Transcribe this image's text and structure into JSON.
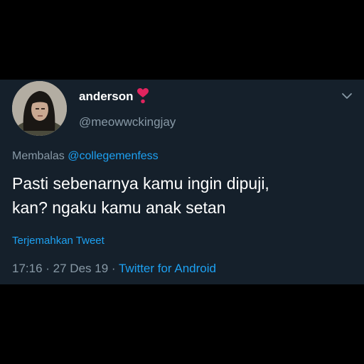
{
  "tweet": {
    "author": {
      "display_name": "anderson",
      "name_emoji": "heart-exclamation-emoji",
      "handle": "@meowwckingjay"
    },
    "reply": {
      "prefix": "Membalas",
      "mention": "@collegemenfess"
    },
    "text": {
      "line1": "Pasti sebenarnya kamu ingin dipuji,",
      "line2": "kan? ngaku kamu anak setan"
    },
    "translate_label": "Terjemahkan Tweet",
    "meta": {
      "time": "17:16",
      "separator1": " · ",
      "date": "27 Des 19",
      "separator2": " · ",
      "source": "Twitter for Android"
    },
    "menu_icon": "chevron-down-icon"
  },
  "colors": {
    "background": "#000000",
    "card": "#15202b",
    "text_primary": "#ffffff",
    "text_secondary": "#8899a6",
    "link": "#1da1f2",
    "heart": "#e0245e"
  }
}
